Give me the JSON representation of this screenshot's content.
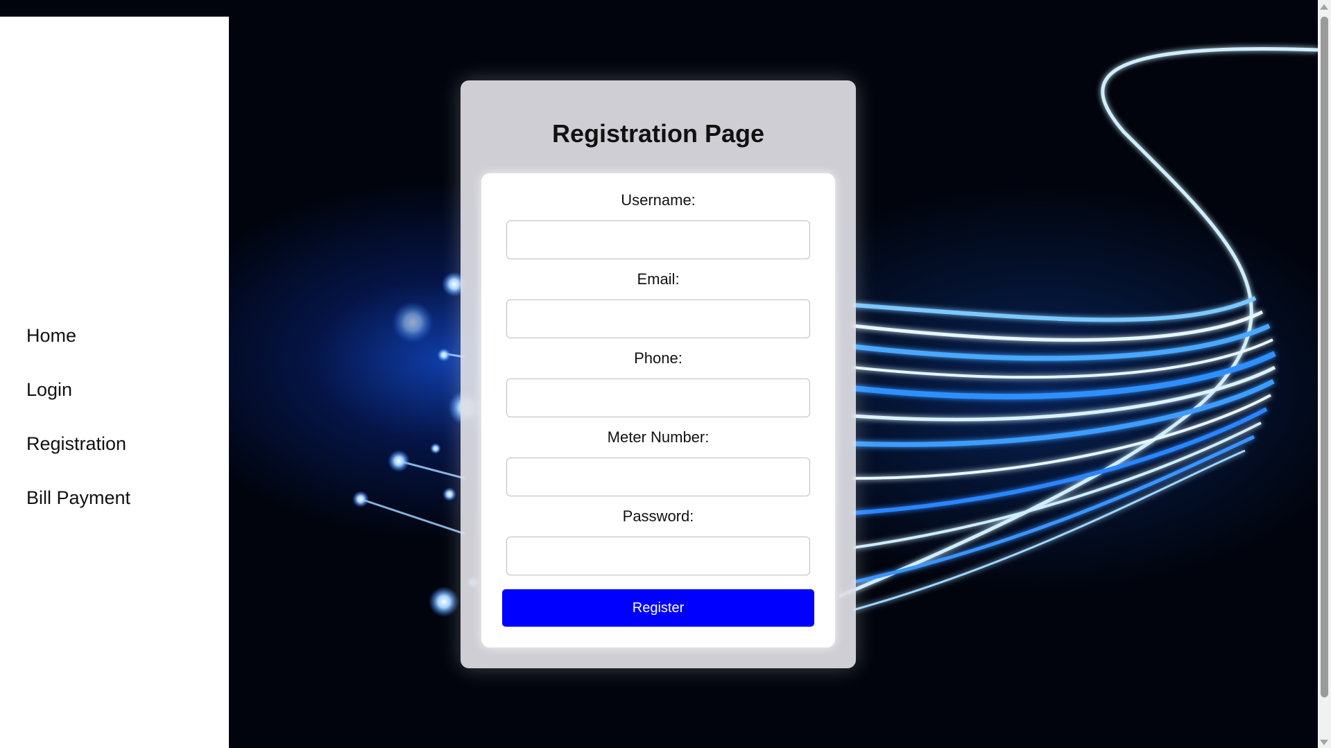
{
  "sidebar": {
    "items": [
      {
        "label": "Home"
      },
      {
        "label": "Login"
      },
      {
        "label": "Registration"
      },
      {
        "label": "Bill Payment"
      }
    ]
  },
  "form": {
    "title": "Registration Page",
    "fields": [
      {
        "label": "Username:",
        "value": "",
        "type": "text"
      },
      {
        "label": "Email:",
        "value": "",
        "type": "email"
      },
      {
        "label": "Phone:",
        "value": "",
        "type": "tel"
      },
      {
        "label": "Meter Number:",
        "value": "",
        "type": "text"
      },
      {
        "label": "Password:",
        "value": "",
        "type": "password"
      }
    ],
    "submit_label": "Register"
  },
  "colors": {
    "button": "#0000ff",
    "sidebar_bg": "#ffffff",
    "card_bg": "#dedee4",
    "background": "#01040d"
  },
  "icons": {
    "scroll_up": "chevron-up-icon",
    "scroll_down": "chevron-down-icon"
  }
}
